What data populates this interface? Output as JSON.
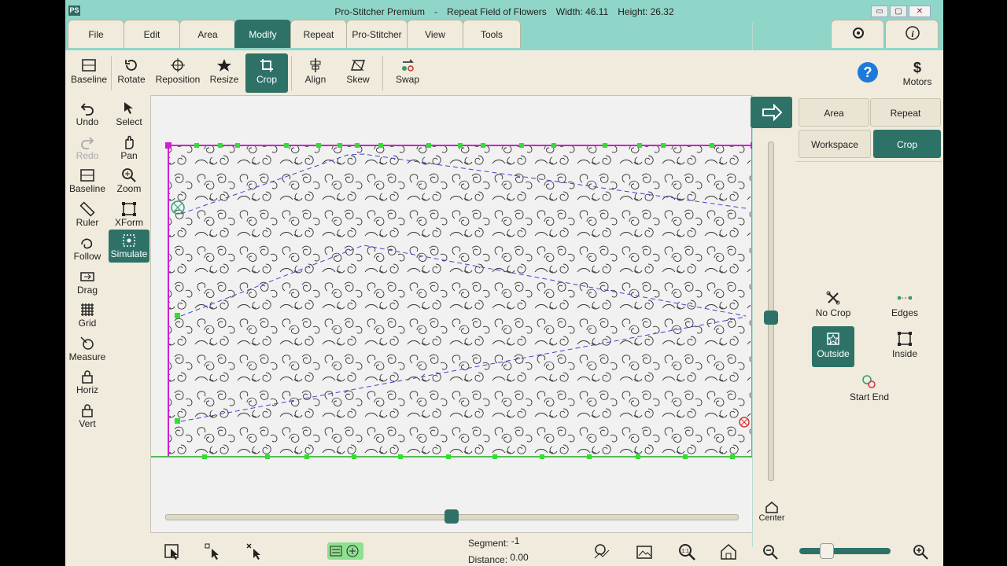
{
  "title": {
    "app": "Pro-Stitcher Premium",
    "dash": "-",
    "pattern": "Repeat Field of Flowers",
    "width": "Width: 46.11",
    "height": "Height: 26.32",
    "icon": "PS"
  },
  "window_controls": {
    "minimize": "▭",
    "maximize": "▢",
    "close": "✕"
  },
  "tabs": [
    {
      "label": "File"
    },
    {
      "label": "Edit"
    },
    {
      "label": "Area"
    },
    {
      "label": "Modify"
    },
    {
      "label": "Repeat"
    },
    {
      "label": "Pro-Stitcher"
    },
    {
      "label": "View"
    },
    {
      "label": "Tools"
    }
  ],
  "active_tab": "Modify",
  "toolbar": [
    {
      "label": "Baseline",
      "icon": "baseline-icon"
    },
    {
      "label": "Rotate",
      "icon": "rotate-icon"
    },
    {
      "label": "Reposition",
      "icon": "reposition-icon"
    },
    {
      "label": "Resize",
      "icon": "resize-icon"
    },
    {
      "label": "Crop",
      "icon": "crop-icon"
    },
    {
      "label": "Align",
      "icon": "align-icon"
    },
    {
      "label": "Skew",
      "icon": "skew-icon"
    },
    {
      "label": "Swap",
      "icon": "swap-icon"
    }
  ],
  "right_top": {
    "motors_label": "Motors",
    "motors_icon": "$",
    "help_icon": "?",
    "info_icon": "i"
  },
  "left_tools": [
    {
      "label": "Undo"
    },
    {
      "label": "Select"
    },
    {
      "label": "Redo"
    },
    {
      "label": "Pan"
    },
    {
      "label": "Baseline"
    },
    {
      "label": "Zoom"
    },
    {
      "label": "Ruler"
    },
    {
      "label": "XForm"
    },
    {
      "label": "Follow"
    },
    {
      "label": "Simulate"
    },
    {
      "label": "Drag"
    },
    {
      "label": "Grid"
    },
    {
      "label": "Measure"
    },
    {
      "label": "Horiz"
    },
    {
      "label": "Vert"
    }
  ],
  "right_panel": {
    "buttons": [
      {
        "label": "Area"
      },
      {
        "label": "Repeat"
      },
      {
        "label": "Workspace"
      },
      {
        "label": "Crop"
      }
    ],
    "crop_options": [
      {
        "label": "No Crop"
      },
      {
        "label": "Edges"
      },
      {
        "label": "Outside"
      },
      {
        "label": "Inside"
      },
      {
        "label": "Start End"
      }
    ]
  },
  "canvas": {
    "center_label": "Center",
    "horizontal_slider": 0.5,
    "vertical_slider": 0.52
  },
  "status": {
    "segment_label": "Segment:",
    "segment_value": "-1",
    "distance_label": "Distance:",
    "distance_value": "0.00",
    "zoom_slider": 0.3
  },
  "colors": {
    "teal": "#2e7267",
    "title_bg": "#8fd6c8",
    "panel_bg": "#f0ebdc",
    "crop_line": "#d020d0",
    "boundary": "#22aa22",
    "node": "#33dd33",
    "path": "#4444cc"
  }
}
